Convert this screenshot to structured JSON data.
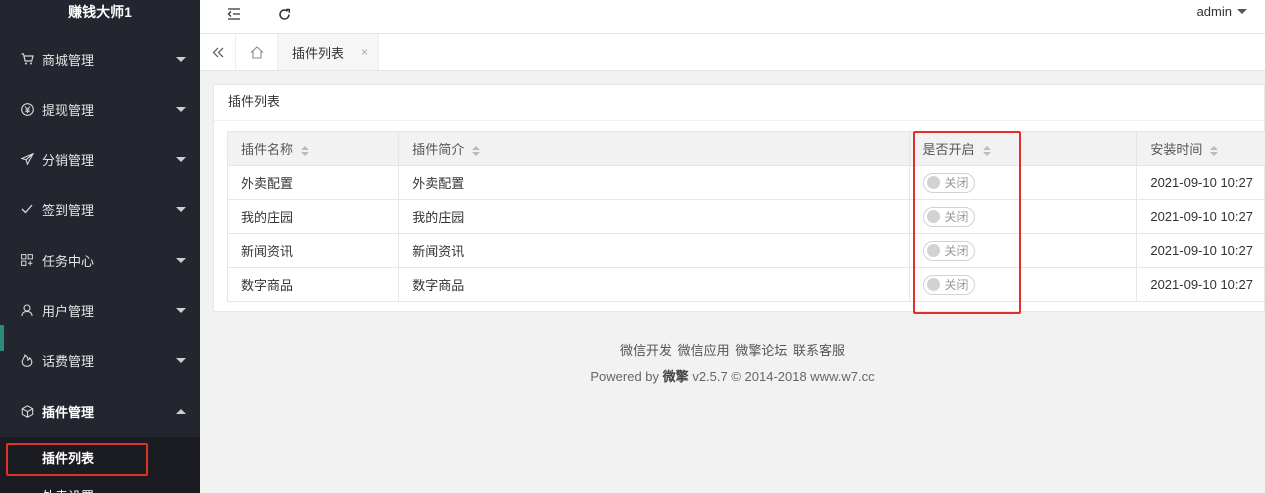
{
  "sidebar": {
    "brand": "赚钱大师1",
    "items": [
      {
        "label": "商城管理",
        "icon": "cart-icon"
      },
      {
        "label": "提现管理",
        "icon": "yen-icon"
      },
      {
        "label": "分销管理",
        "icon": "send-icon"
      },
      {
        "label": "签到管理",
        "icon": "check-icon"
      },
      {
        "label": "任务中心",
        "icon": "apps-icon"
      },
      {
        "label": "用户管理",
        "icon": "user-icon"
      },
      {
        "label": "话费管理",
        "icon": "fire-icon"
      },
      {
        "label": "插件管理",
        "icon": "cube-icon"
      }
    ],
    "sub_items": [
      {
        "label": "插件列表"
      },
      {
        "label": "外卖设置"
      }
    ]
  },
  "header": {
    "user": "admin"
  },
  "tabs": [
    {
      "label": "插件列表",
      "close": "×"
    }
  ],
  "card": {
    "title": "插件列表",
    "columns": [
      "插件名称",
      "插件简介",
      "是否开启",
      "安装时间"
    ],
    "rows": [
      {
        "name": "外卖配置",
        "desc": "外卖配置",
        "enabled": "关闭",
        "time": "2021-09-10 10:27"
      },
      {
        "name": "我的庄园",
        "desc": "我的庄园",
        "enabled": "关闭",
        "time": "2021-09-10 10:27"
      },
      {
        "name": "新闻资讯",
        "desc": "新闻资讯",
        "enabled": "关闭",
        "time": "2021-09-10 10:27"
      },
      {
        "name": "数字商品",
        "desc": "数字商品",
        "enabled": "关闭",
        "time": "2021-09-10 10:27"
      }
    ]
  },
  "footer": {
    "links": [
      "微信开发",
      "微信应用",
      "微擎论坛",
      "联系客服"
    ],
    "powered_prefix": "Powered by",
    "powered_brand": "微擎",
    "powered_suffix": "v2.5.7 © 2014-2018 www.w7.cc"
  },
  "colors": {
    "sidebar_bg": "#23262e",
    "highlight_red": "#e0302a",
    "active_marker": "#2d8a7b"
  }
}
